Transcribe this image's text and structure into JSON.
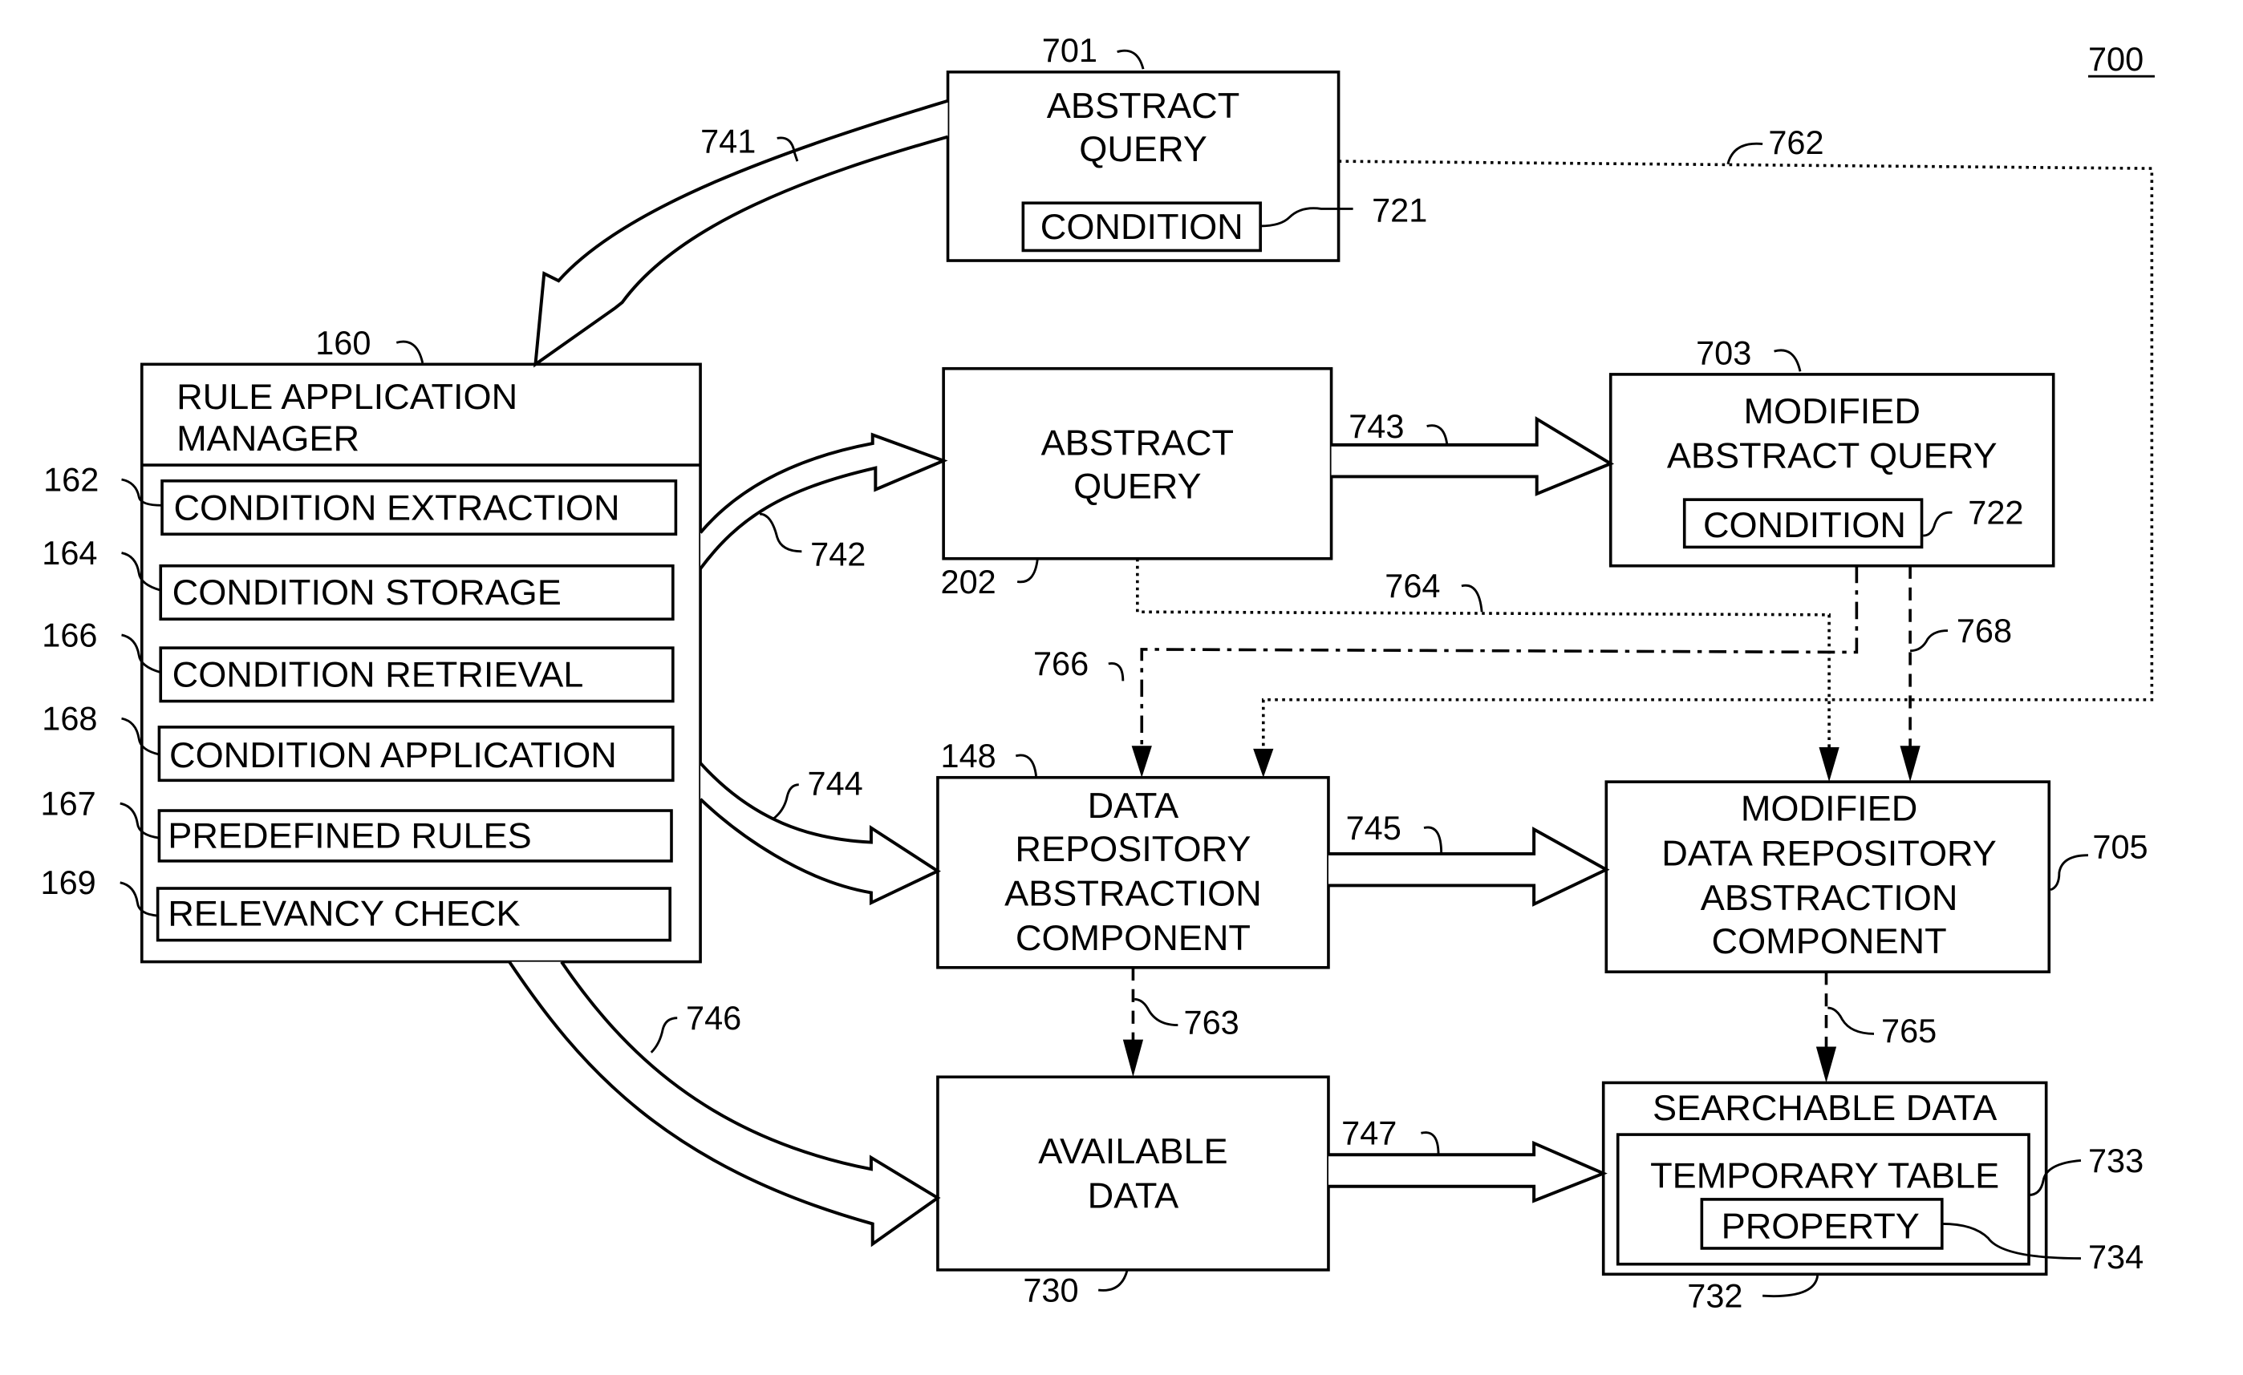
{
  "figure": {
    "number": "700"
  },
  "boxes": {
    "abstract_query_top": {
      "ref": "701",
      "lines": [
        "ABSTRACT",
        "QUERY"
      ],
      "condition": {
        "label": "CONDITION",
        "ref": "721"
      }
    },
    "rule_manager": {
      "ref": "160",
      "lines": [
        "RULE  APPLICATION",
        "MANAGER"
      ],
      "items": [
        {
          "ref": "162",
          "label": "CONDITION EXTRACTION"
        },
        {
          "ref": "164",
          "label": "CONDITION STORAGE"
        },
        {
          "ref": "166",
          "label": "CONDITION RETRIEVAL"
        },
        {
          "ref": "168",
          "label": "CONDITION APPLICATION"
        },
        {
          "ref": "167",
          "label": "PREDEFINED RULES"
        },
        {
          "ref": "169",
          "label": "RELEVANCY CHECK"
        }
      ]
    },
    "abstract_query_mid": {
      "ref": "202",
      "lines": [
        "ABSTRACT",
        "QUERY"
      ]
    },
    "modified_query": {
      "ref": "703",
      "lines": [
        "MODIFIED",
        "ABSTRACT QUERY"
      ],
      "condition": {
        "label": "CONDITION",
        "ref": "722"
      }
    },
    "drac": {
      "ref": "148",
      "lines": [
        "DATA",
        "REPOSITORY",
        "ABSTRACTION",
        "COMPONENT"
      ]
    },
    "modified_drac": {
      "ref": "705",
      "lines": [
        "MODIFIED",
        "DATA REPOSITORY",
        "ABSTRACTION",
        "COMPONENT"
      ]
    },
    "available_data": {
      "ref": "730",
      "lines": [
        "AVAILABLE",
        "DATA"
      ]
    },
    "searchable_data": {
      "ref": "732",
      "title": "SEARCHABLE DATA",
      "temp_table": {
        "label": "TEMPORARY TABLE",
        "ref": "733"
      },
      "property": {
        "label": "PROPERTY",
        "ref": "734"
      }
    }
  },
  "arrows": {
    "a741": "741",
    "a742": "742",
    "a743": "743",
    "a744": "744",
    "a745": "745",
    "a746": "746",
    "a747": "747",
    "l762": "762",
    "l763": "763",
    "l764": "764",
    "l765": "765",
    "l766": "766",
    "l768": "768"
  }
}
